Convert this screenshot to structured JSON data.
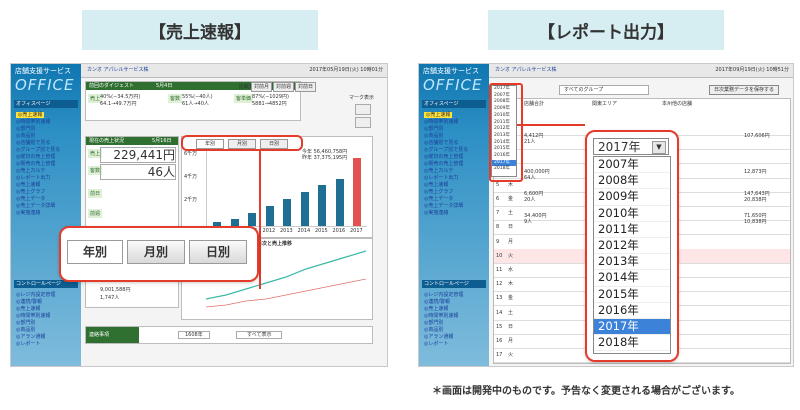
{
  "banners": {
    "left": "【売上速報】",
    "right": "【レポート出力】"
  },
  "footnote": "＊画面は開発中のものです。予告なく変更される場合がございます。",
  "app": {
    "logo_small": "店舗支援サービス",
    "logo_big": "OFFICE",
    "company": "カンオ アパレルサービス株",
    "date_left": "2017年05月19日(火) 10時01分",
    "date_right": "2017年09月19日(火) 10時51分"
  },
  "nav": {
    "office_page": "オフィスページ",
    "control_page": "コントロールページ",
    "items_left": [
      "売上速報",
      "時間帯別速報",
      "部門別",
      "商品別",
      "店舗別で見る",
      "グループ別で見る",
      "曜日の売上管理",
      "販売の売上管理",
      "売上カルテ",
      "レポート出力",
      "売上速報",
      "売上グラフ",
      "売上データ",
      "売上データ詳細",
      "実施連絡",
      "レジ内設定管理",
      "連続/警報",
      "売上速報",
      "時間帯別速報",
      "部門別",
      "商品別",
      "アラン通報",
      "レポート"
    ],
    "items_right": [
      "売上速報",
      "時間帯別速報",
      "部門別",
      "商品別",
      "店舗別で見る",
      "グループ別で見る",
      "曜日の売上管理",
      "販売の売上管理",
      "売上カルテ",
      "レポート出力",
      "売上速報",
      "売上グラフ",
      "売上データ",
      "売上データ詳細",
      "実施連絡",
      "レジ内設定管理",
      "連続/警報",
      "売上速報",
      "時間帯別速報",
      "部門別",
      "商品別",
      "アラン通報",
      "レポート"
    ]
  },
  "left_screen": {
    "digest_title": "前回のダイジェスト",
    "digest_date": "5月4日",
    "digest_rows": [
      "40%(−34.5万円)",
      "64.1→49.7万円"
    ],
    "digest_mid": [
      "55%(−40人)",
      "61人→40人"
    ],
    "digest_right": [
      "87%(−1029円)",
      "5881→4852円"
    ],
    "period_label": "比較日",
    "period_buttons": [
      "対前月",
      "対前週",
      "対前日"
    ],
    "mark_label": "マーク表示",
    "sales_title": "現在の売上状況",
    "sales_date": "5月16日",
    "sales_amount": "229,441円",
    "sales_customers": "46人",
    "sales_labels": [
      "売上",
      "客数",
      "前日",
      "前週",
      "目標"
    ],
    "tabs_small": [
      "年別",
      "月別",
      "日別"
    ],
    "tabs_zoom": [
      "年別",
      "月別",
      "日別"
    ],
    "chart_legend": [
      "今年 56,460,758円",
      "昨年 37,375,195円"
    ],
    "y_labels": [
      "6千万",
      "4千万",
      "2千万"
    ],
    "x_labels": [
      "2009",
      "2010",
      "2011",
      "2012",
      "2013",
      "2014",
      "2015",
      "2016",
      "2017"
    ],
    "bottom_amount": "9,001,588円",
    "bottom_count": "1,747人",
    "lower_chart_title": "月日の日次と売上推移",
    "lower_chart_y": "400万",
    "notice_title": "連絡事項",
    "notice_select": "1608年",
    "notice_select2": "すべて表示"
  },
  "right_screen": {
    "group_select": "すべてのグループ",
    "export_button": "日次業務データを保存する",
    "small_years": [
      "2017年",
      "2007年",
      "2008年",
      "2009年",
      "2010年",
      "2011年",
      "2012年",
      "2013年",
      "2014年",
      "2015年",
      "2016年",
      "2017年",
      "2018年"
    ],
    "col_headers": [
      "店舗合計",
      "関東エリア",
      "本州他の店舗"
    ],
    "sub_headers": [
      "売上\n目標",
      "予算\n達成率",
      "日報",
      "天気\n情報",
      "日報",
      "予算\n達成率",
      "日報"
    ],
    "row_values": [
      "4,412円",
      "21人",
      "400,000円",
      "64人",
      "6,600円",
      "20人",
      "34,400円",
      "9人"
    ],
    "right_values": [
      "107,606円",
      "12,873円",
      "147,643円",
      "20,838円",
      "71,650円",
      "10,838円"
    ],
    "day_numbers": [
      "1",
      "2",
      "3",
      "4",
      "5",
      "6",
      "7",
      "8",
      "9",
      "10",
      "11",
      "12",
      "13",
      "14",
      "15",
      "16",
      "17"
    ],
    "day_labels": [
      "日",
      "月",
      "火",
      "水",
      "木",
      "金",
      "土",
      "日",
      "月",
      "火",
      "水",
      "木",
      "金",
      "土",
      "日",
      "月",
      "火"
    ],
    "dropdown_selected": "2017年",
    "dropdown_options": [
      "2007年",
      "2008年",
      "2009年",
      "2010年",
      "2011年",
      "2012年",
      "2013年",
      "2014年",
      "2015年",
      "2016年",
      "2017年",
      "2018年"
    ],
    "dropdown_highlight": "2017年"
  },
  "chart_data": {
    "type": "bar",
    "categories": [
      "2009",
      "2010",
      "2011",
      "2012",
      "2013",
      "2014",
      "2015",
      "2016",
      "2017"
    ],
    "series": [
      {
        "values": [
          0.2,
          0.4,
          0.7,
          1.1,
          1.5,
          1.9,
          2.3,
          2.6,
          3.8
        ]
      }
    ],
    "ylabel": "",
    "y_ticks": [
      "6千万",
      "4千万",
      "2千万"
    ]
  },
  "colors": {
    "sidebar": "#0f76b0",
    "accent_green": "#2f6f2f",
    "bar": "#1e6f93",
    "bar_last": "#e45151",
    "highlight": "#3b82d8",
    "red_frame": "#e43b2b"
  }
}
